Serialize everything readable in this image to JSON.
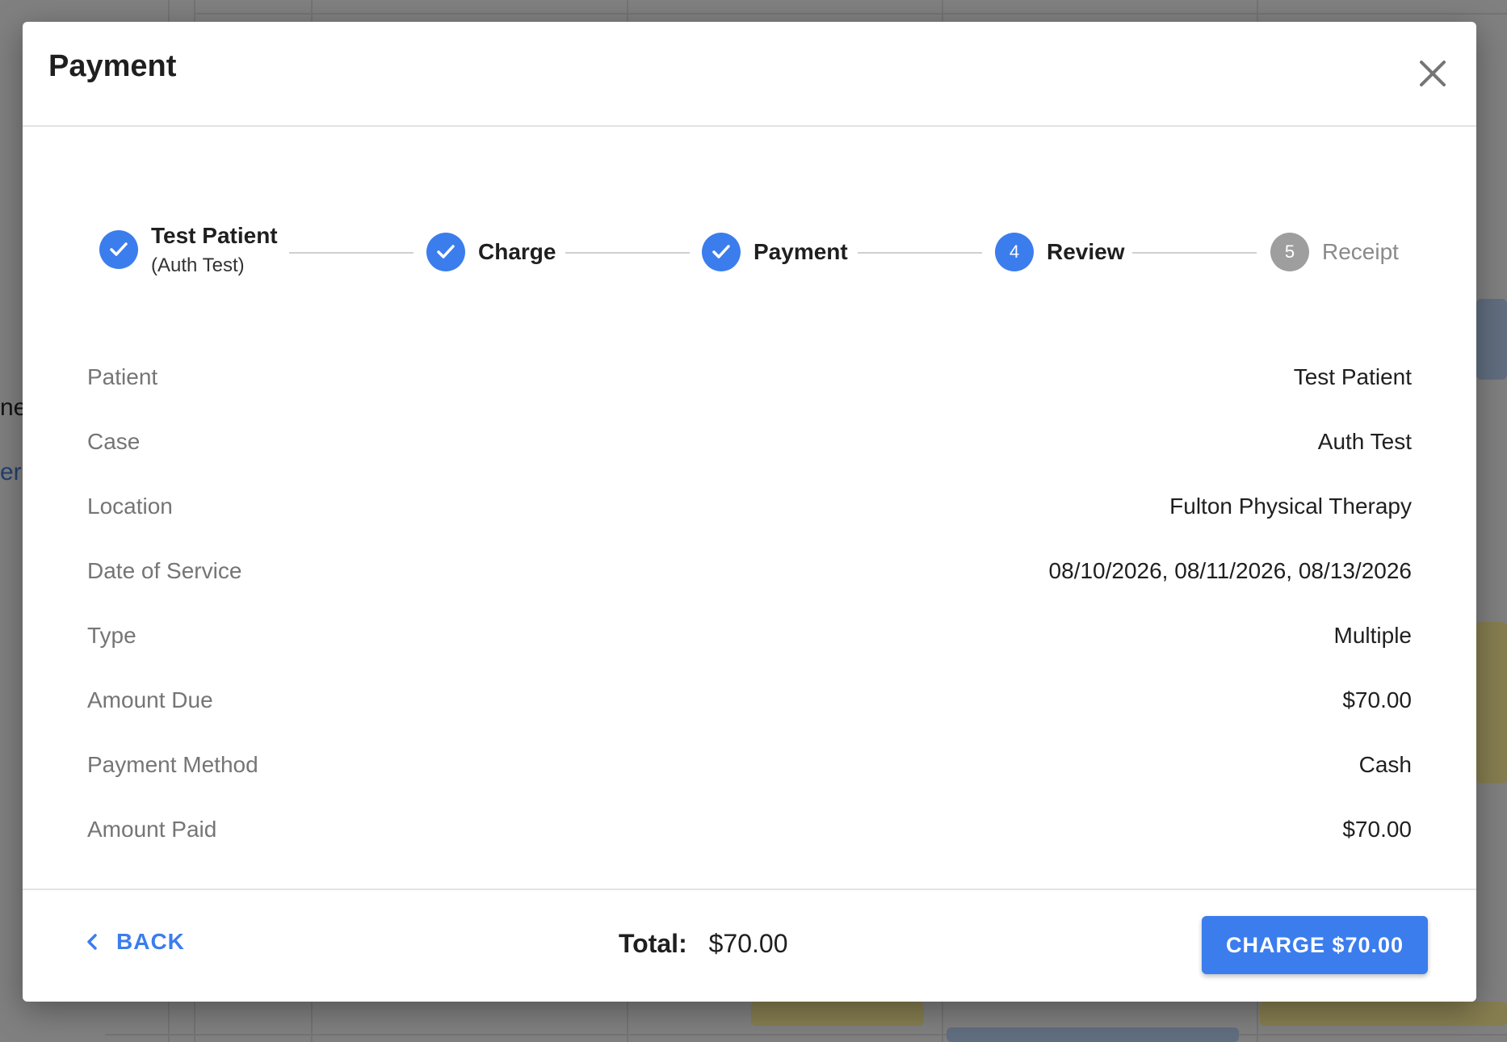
{
  "background": {
    "partial_text_1": "ne",
    "partial_text_2": "era"
  },
  "dialog": {
    "title": "Payment",
    "close_icon": "close-icon"
  },
  "stepper": {
    "steps": [
      {
        "label": "Test Patient",
        "sublabel": "(Auth Test)",
        "state": "done",
        "number": ""
      },
      {
        "label": "Charge",
        "state": "done",
        "number": ""
      },
      {
        "label": "Payment",
        "state": "done",
        "number": ""
      },
      {
        "label": "Review",
        "state": "active",
        "number": "4"
      },
      {
        "label": "Receipt",
        "state": "todo",
        "number": "5"
      }
    ]
  },
  "review": {
    "rows": [
      {
        "label": "Patient",
        "value": "Test Patient"
      },
      {
        "label": "Case",
        "value": "Auth Test"
      },
      {
        "label": "Location",
        "value": "Fulton Physical Therapy"
      },
      {
        "label": "Date of Service",
        "value": "08/10/2026, 08/11/2026, 08/13/2026"
      },
      {
        "label": "Type",
        "value": "Multiple"
      },
      {
        "label": "Amount Due",
        "value": "$70.00"
      },
      {
        "label": "Payment Method",
        "value": "Cash"
      },
      {
        "label": "Amount Paid",
        "value": "$70.00"
      }
    ]
  },
  "footer": {
    "back_label": "BACK",
    "total_label": "Total:",
    "total_value": "$70.00",
    "charge_label": "CHARGE $70.00"
  },
  "colors": {
    "accent": "#3b7ded",
    "step_todo": "#9e9e9e"
  }
}
